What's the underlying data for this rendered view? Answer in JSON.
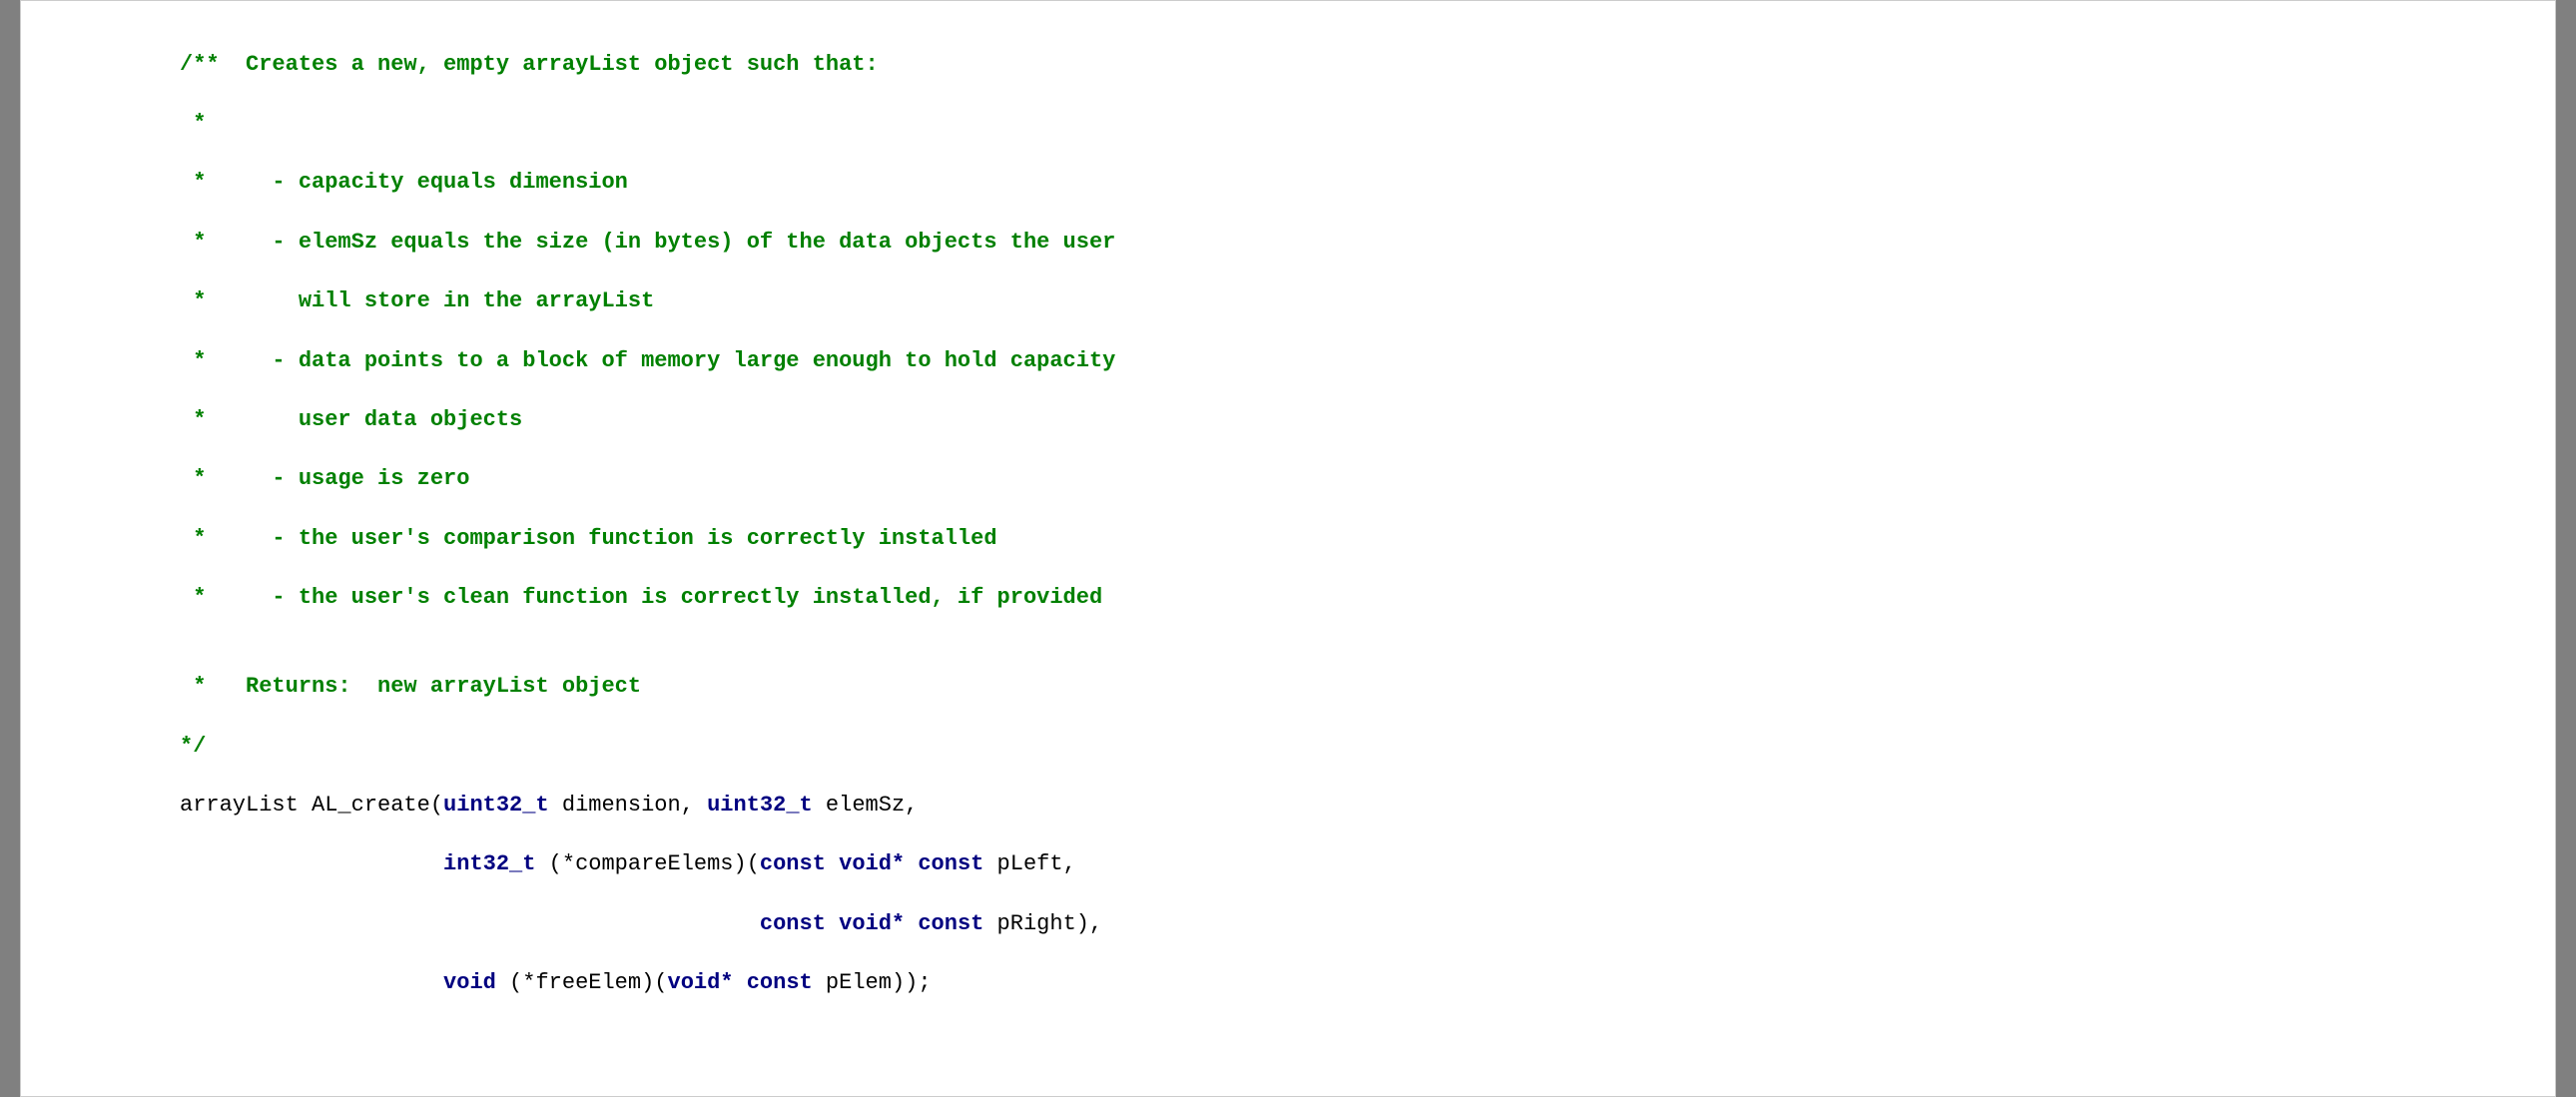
{
  "comment": {
    "l1": "/**  Creates a new, empty arrayList object such that:",
    "l2": " *",
    "l3": " *     - capacity equals dimension",
    "l4": " *     - elemSz equals the size (in bytes) of the data objects the user",
    "l5": " *       will store in the arrayList",
    "l6": " *     - data points to a block of memory large enough to hold capacity",
    "l7": " *       user data objects",
    "l8": " *     - usage is zero",
    "l9": " *     - the user's comparison function is correctly installed",
    "l10": " *     - the user's clean function is correctly installed, if provided",
    "l11": "",
    "l12": " *   Returns:  new arrayList object",
    "l13": "*/"
  },
  "sig": {
    "p1a": "arrayList AL_create(",
    "t1": "uint32_t",
    "p1b": " dimension, ",
    "t2": "uint32_t",
    "p1c": " elemSz,",
    "pad2": "                    ",
    "t3": "int32_t",
    "p2a": " (*compareElems)(",
    "kw1": "const",
    "sp1": " ",
    "t4": "void*",
    "sp2": " ",
    "kw2": "const",
    "p2b": " pLeft,",
    "pad3": "                                            ",
    "kw3": "const",
    "sp3": " ",
    "t5": "void*",
    "sp4": " ",
    "kw4": "const",
    "p3b": " pRight),",
    "pad4": "                    ",
    "t6": "void",
    "p4a": " (*freeElem)(",
    "t7": "void*",
    "sp5": " ",
    "kw5": "const",
    "p4b": " pElem));"
  }
}
